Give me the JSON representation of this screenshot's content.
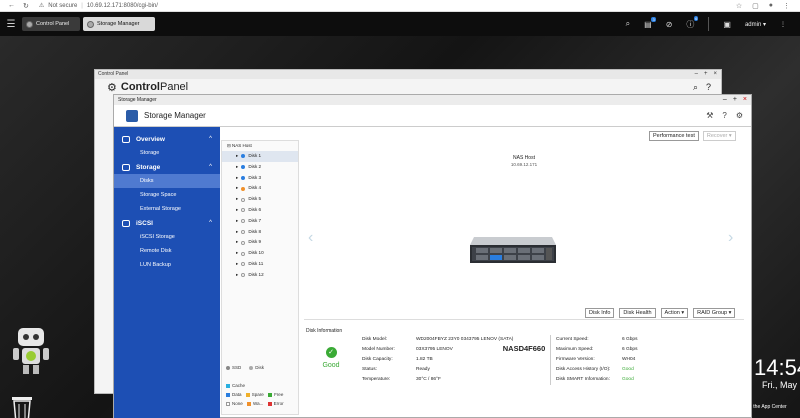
{
  "browser": {
    "security": "Not secure",
    "url": "10.69.12.171:8080/cgi-bin/"
  },
  "qnap": {
    "tabs": [
      {
        "label": "Control Panel"
      },
      {
        "label": "Storage Manager"
      }
    ],
    "badge1": "3",
    "badge2": "6",
    "user": "admin"
  },
  "cp": {
    "titlebar": "Control Panel",
    "title_a": "Control",
    "title_b": "Panel"
  },
  "sm": {
    "titlebar": "Storage Manager",
    "title": "Storage Manager",
    "sidebar": {
      "overview": "Overview",
      "storage_sub": "Storage",
      "storage": "Storage",
      "disks": "Disks",
      "storage_space": "Storage Space",
      "external": "External Storage",
      "iscsi": "iSCSI",
      "iscsi_storage": "iSCSI Storage",
      "remote_disk": "Remote Disk",
      "lun_backup": "LUN Backup"
    },
    "tree": {
      "root": "NAS Host",
      "disks": [
        "Disk 1",
        "Disk 2",
        "Disk 3",
        "Disk 4",
        "Disk 5",
        "Disk 6",
        "Disk 7",
        "Disk 8",
        "Disk 9",
        "Disk 10",
        "Disk 11",
        "Disk 12"
      ]
    },
    "legend": {
      "ssd": "SSD",
      "disk": "Disk",
      "cache": "Cache",
      "data": "Data",
      "spare": "Spare",
      "free": "Free",
      "none": "None",
      "warning": "Wa...",
      "error": "Error"
    },
    "buttons": {
      "perf": "Performance test",
      "recover": "Recover ▾",
      "info": "Disk Info",
      "health": "Disk Health",
      "action": "Action ▾",
      "raid": "RAID Group ▾"
    },
    "nas": {
      "host": "NAS Host",
      "ip": "10.69.12.171",
      "model": "NASD4F660"
    },
    "disk_info": {
      "heading": "Disk Information",
      "status": "Good",
      "left": [
        {
          "k": "Disk Model:",
          "v": "WD2004FBYZ 23Y0 0343795 LENOV (SATA)"
        },
        {
          "k": "Model Number:",
          "v": "03X3795 LENOV"
        },
        {
          "k": "Disk Capacity:",
          "v": "1.82 TB"
        },
        {
          "k": "Status:",
          "v": "Ready"
        },
        {
          "k": "Temperature:",
          "v": "30°C / 86°F"
        }
      ],
      "right": [
        {
          "k": "Current Speed:",
          "v": "6 Gbps"
        },
        {
          "k": "Maximum Speed:",
          "v": "6 Gbps"
        },
        {
          "k": "Firmware Version:",
          "v": "WH04"
        },
        {
          "k": "Disk Access History (I/O):",
          "v": "Good"
        },
        {
          "k": "Disk SMART Information:",
          "v": "Good"
        }
      ]
    }
  },
  "desktop": {
    "time": "14:54",
    "date": "Fri., May",
    "appcenter": "in the App Center"
  }
}
